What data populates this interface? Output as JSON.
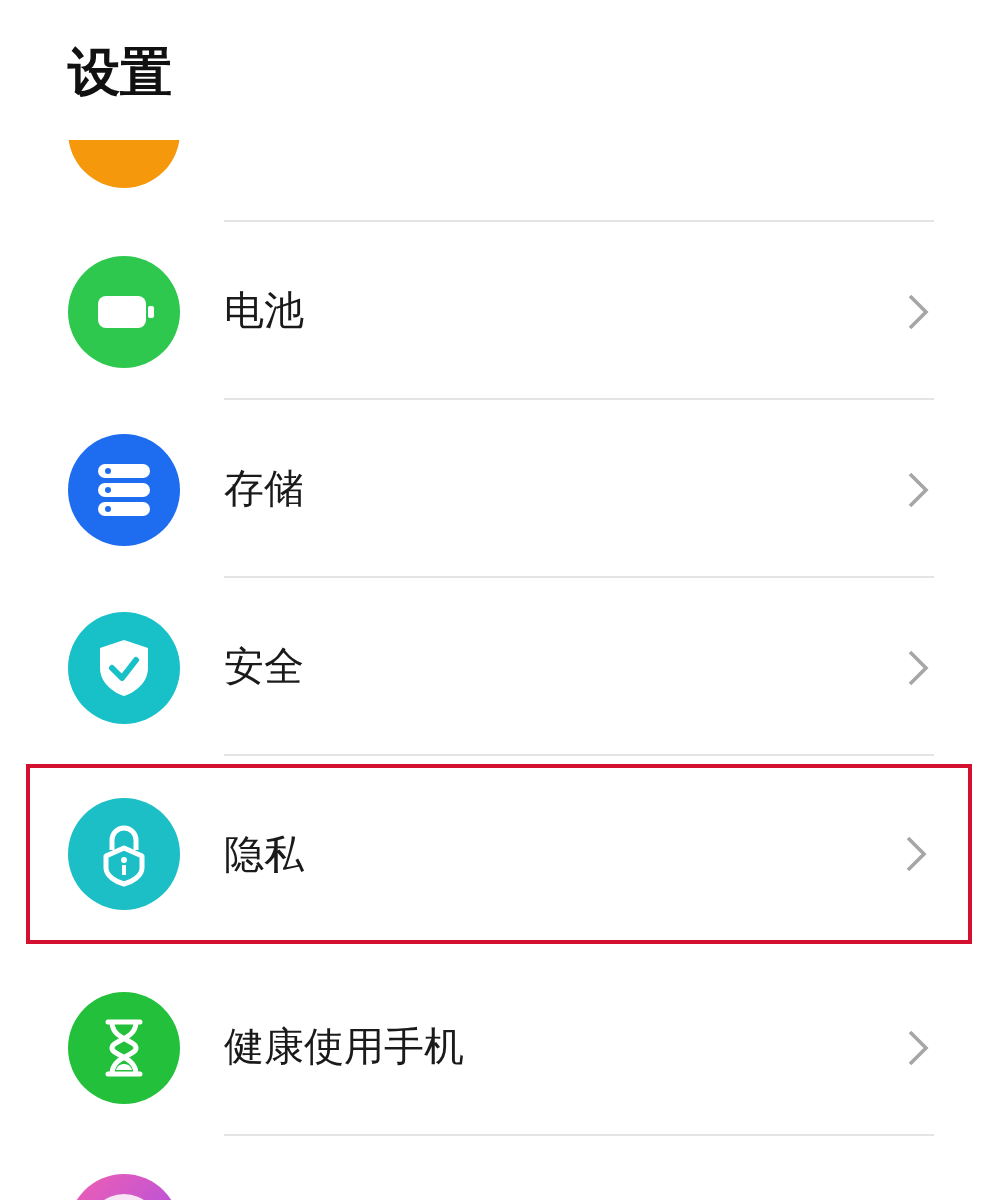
{
  "header": {
    "title": "设置"
  },
  "items": [
    {
      "kind": "partial"
    },
    {
      "kind": "row",
      "label": "电池",
      "highlighted": false
    },
    {
      "kind": "row",
      "label": "存储",
      "highlighted": false
    },
    {
      "kind": "row",
      "label": "安全",
      "highlighted": false
    },
    {
      "kind": "row",
      "label": "隐私",
      "highlighted": true
    },
    {
      "kind": "row",
      "label": "健康使用手机",
      "highlighted": false
    },
    {
      "kind": "partial"
    }
  ]
}
